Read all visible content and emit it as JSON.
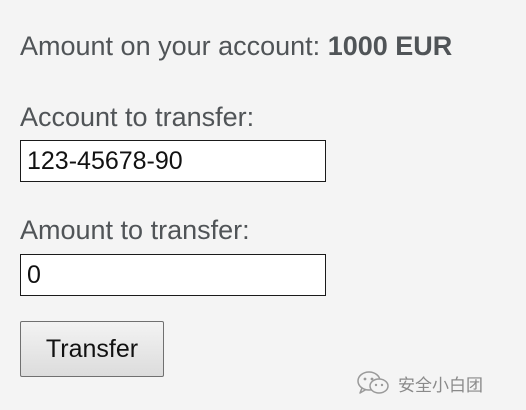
{
  "balance": {
    "label": "Amount on your account:",
    "value": "1000 EUR"
  },
  "transfer_form": {
    "account_label": "Account to transfer:",
    "account_value": "123-45678-90",
    "amount_label": "Amount to transfer:",
    "amount_value": "0",
    "submit_label": "Transfer"
  },
  "watermark": {
    "icon": "wechat-logo-icon",
    "text": "安全小白团"
  }
}
